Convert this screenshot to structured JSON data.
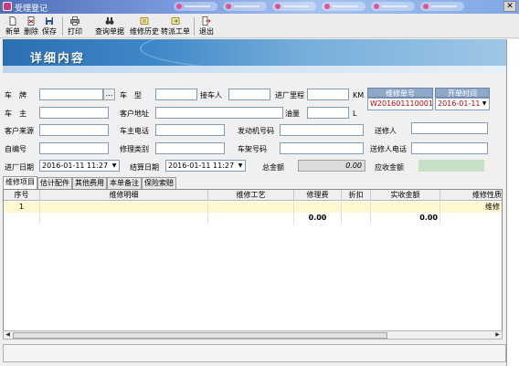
{
  "window": {
    "title": "受理登记"
  },
  "toolbar": {
    "buttons": [
      {
        "key": "new",
        "label": "新单",
        "icon": "new-doc-icon"
      },
      {
        "key": "delete",
        "label": "删除",
        "icon": "delete-icon"
      },
      {
        "key": "save",
        "label": "保存",
        "icon": "save-icon"
      },
      {
        "key": "print",
        "label": "打印",
        "icon": "print-icon"
      },
      {
        "key": "query",
        "label": "查询单据",
        "icon": "binoculars-icon"
      },
      {
        "key": "history",
        "label": "维修历史",
        "icon": "history-icon"
      },
      {
        "key": "transfer",
        "label": "转派工单",
        "icon": "transfer-icon"
      },
      {
        "key": "exit",
        "label": "退出",
        "icon": "exit-icon"
      }
    ]
  },
  "banner": {
    "title": "详细内容"
  },
  "form": {
    "plate_label": "车　牌",
    "model_label": "车　型",
    "receiver_label": "接车人",
    "mileage_label": "进厂里程",
    "mileage_unit": "KM",
    "owner_label": "车　主",
    "owner_addr_label": "客户地址",
    "fuel_label": "油量",
    "fuel_unit": "L",
    "source_label": "客户来源",
    "phone_label": "车主电话",
    "engine_label": "发动机号码",
    "sender_label": "送修人",
    "code_label": "自编号",
    "repair_type_label": "修理类别",
    "frame_label": "车架号码",
    "sender_phone_label": "送修人电话",
    "in_date_label": "进厂日期",
    "in_date_value": "2016-01-11 11:27",
    "settle_date_label": "结算日期",
    "settle_date_value": "2016-01-11 11:27",
    "total_label": "总金额",
    "total_value": "0.00",
    "receivable_label": "应收金额",
    "order_no_label": "维修单号",
    "order_no_value": "W201601110001",
    "open_date_label": "开单时间",
    "open_date_value": "2016-01-11"
  },
  "tabs": [
    {
      "label": "维修项目",
      "active": true
    },
    {
      "label": "估计配件",
      "active": false
    },
    {
      "label": "其他费用",
      "active": false
    },
    {
      "label": "本单备注",
      "active": false
    },
    {
      "label": "保险索赔",
      "active": false
    }
  ],
  "grid": {
    "columns": [
      "序号",
      "维修明细",
      "维修工艺",
      "修理费",
      "折扣",
      "实收金额",
      "维修性质"
    ],
    "rows": [
      {
        "seq": "1",
        "detail": "",
        "craft": "",
        "fee": "",
        "discount": "",
        "amount": "",
        "nature": "维修"
      }
    ],
    "totals": {
      "fee": "0.00",
      "amount": "0.00"
    }
  }
}
